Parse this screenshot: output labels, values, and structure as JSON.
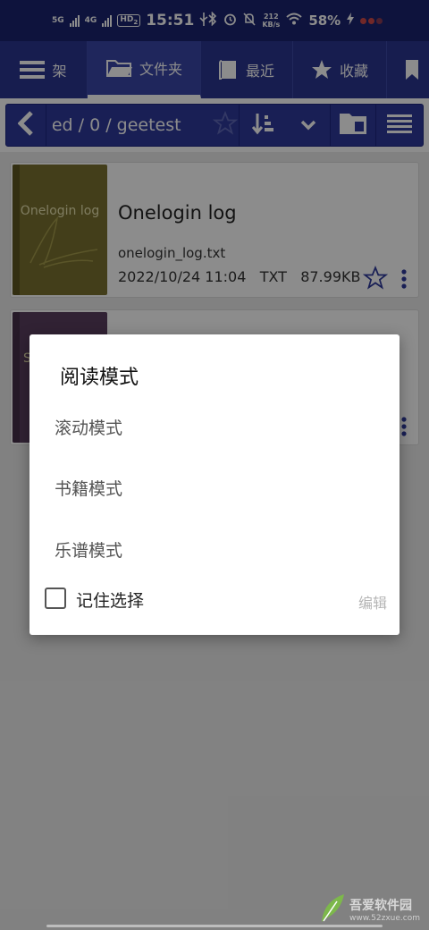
{
  "status_bar": {
    "net1": "5G",
    "net2": "4G",
    "hd": "HD",
    "hd_sub": "2",
    "time": "15:51",
    "speed_value": "212",
    "speed_unit": "KB/s",
    "battery": "58%"
  },
  "tabs": [
    {
      "label": "架",
      "icon": "bookshelf-icon"
    },
    {
      "label": "文件夹",
      "icon": "folder-icon",
      "active": true
    },
    {
      "label": "最近",
      "icon": "book-icon"
    },
    {
      "label": "收藏",
      "icon": "star-icon"
    },
    {
      "label": "",
      "icon": "bookmark-icon"
    }
  ],
  "path_bar": {
    "path": "ed / 0 / geetest"
  },
  "books": [
    {
      "title": "Onelogin log",
      "cover_text": "Onelogin log",
      "filename": "onelogin_log.txt",
      "date": "2022/10/24 11:04",
      "type": "TXT",
      "size": "87.99KB",
      "cover_color": "#7a7230"
    },
    {
      "cover_text": "S",
      "cover_color": "#5a3f5f"
    }
  ],
  "dialog": {
    "title": "阅读模式",
    "options": [
      "滚动模式",
      "书籍模式",
      "乐谱模式"
    ],
    "remember_label": "记住选择",
    "edit_label": "编辑"
  },
  "watermark": {
    "text": "吾爱软件园",
    "sub": "www.52zxue.com"
  }
}
